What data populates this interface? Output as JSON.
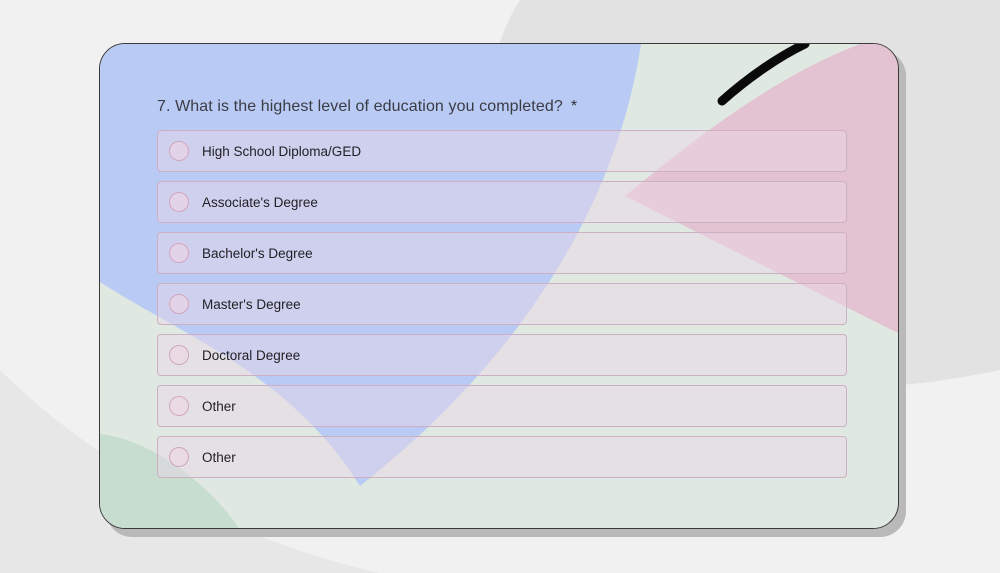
{
  "question": {
    "number_text": "7. What is the highest level of education you completed?",
    "required_mark": "*"
  },
  "options": [
    {
      "label": "High School Diploma/GED"
    },
    {
      "label": "Associate's Degree"
    },
    {
      "label": "Bachelor's Degree"
    },
    {
      "label": "Master's Degree"
    },
    {
      "label": "Doctoral Degree"
    },
    {
      "label": "Other"
    },
    {
      "label": "Other"
    }
  ],
  "colors": {
    "page_background": "#f1f1f1",
    "card_background": "#dfe8e1",
    "blue_shape": "#b9cbf5",
    "pink_shape": "#e3c3d1",
    "green_shape": "#c6ddcf",
    "option_border": "#cdb0c3"
  }
}
